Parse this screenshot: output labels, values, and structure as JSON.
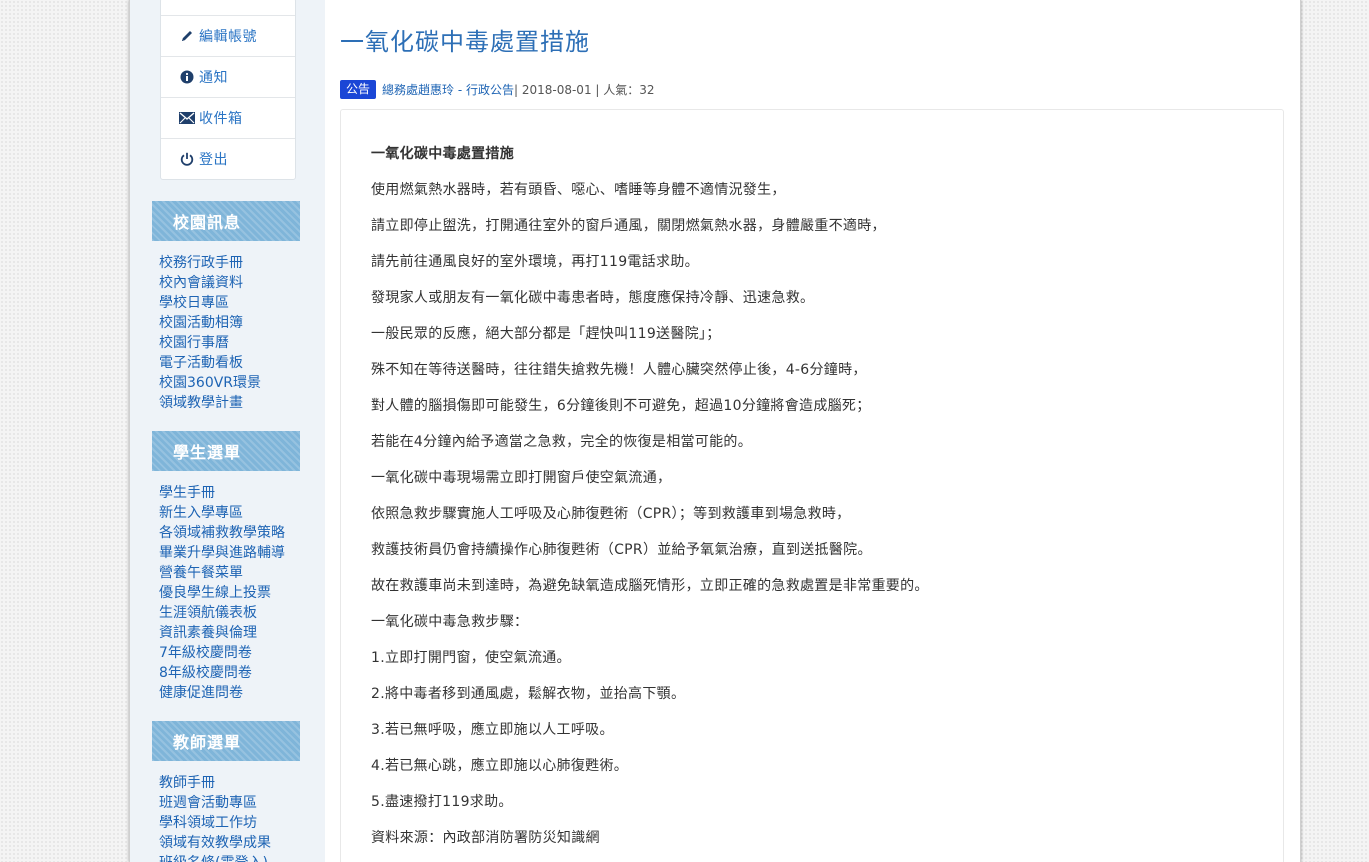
{
  "user_menu": [
    {
      "label": "編輯帳號",
      "icon": "pencil-icon"
    },
    {
      "label": "通知",
      "icon": "info-circle-icon"
    },
    {
      "label": "收件箱",
      "icon": "envelope-icon"
    },
    {
      "label": "登出",
      "icon": "power-icon"
    }
  ],
  "sidebar": {
    "campus": {
      "title": "校園訊息",
      "items": [
        "校務行政手冊",
        "校內會議資料",
        "學校日專區",
        "校園活動相簿",
        "校園行事曆",
        "電子活動看板",
        "校園360VR環景",
        "領域教學計畫"
      ]
    },
    "student": {
      "title": "學生選單",
      "items": [
        "學生手冊",
        "新生入學專區",
        "各領域補救教學策略",
        "畢業升學與進路輔導",
        "營養午餐菜單",
        "優良學生線上投票",
        "生涯領航儀表板",
        "資訊素養與倫理",
        "7年級校慶問卷",
        "8年級校慶問卷",
        "健康促進問卷"
      ]
    },
    "teacher": {
      "title": "教師選單",
      "items": [
        "教師手冊",
        "班週會活動專區",
        "學科領域工作坊",
        "領域有效教學成果",
        "班級名條(需登入)"
      ]
    }
  },
  "article": {
    "title": "一氧化碳中毒處置措施",
    "badge": "公告",
    "author_link": "總務處趙惠玲 - 行政公告",
    "date_views": " | 2018-08-01 | 人氣：32",
    "heading": "一氧化碳中毒處置措施",
    "paragraphs": [
      "使用燃氣熱水器時，若有頭昏、噁心、嗜睡等身體不適情況發生，",
      "請立即停止盥洗，打開通往室外的窗戶通風，關閉燃氣熱水器，身體嚴重不適時，",
      "請先前往通風良好的室外環境，再打119電話求助。",
      "發現家人或朋友有一氧化碳中毒患者時，態度應保持冷靜、迅速急救。",
      "一般民眾的反應，絕大部分都是「趕快叫119送醫院」；",
      "殊不知在等待送醫時，往往錯失搶救先機！人體心臟突然停止後，4-6分鐘時，",
      "對人體的腦損傷即可能發生，6分鐘後則不可避免，超過10分鐘將會造成腦死；",
      "若能在4分鐘內給予適當之急救，完全的恢復是相當可能的。",
      "一氧化碳中毒現場需立即打開窗戶使空氣流通，",
      "依照急救步驟實施人工呼吸及心肺復甦術（CPR）；等到救護車到場急救時，",
      "救護技術員仍會持續操作心肺復甦術（CPR）並給予氧氣治療，直到送抵醫院。",
      "故在救護車尚未到達時，為避免缺氧造成腦死情形，立即正確的急救處置是非常重要的。",
      "一氧化碳中毒急救步驟：",
      "1.立即打開門窗，使空氣流通。",
      "2.將中毒者移到通風處，鬆解衣物，並抬高下顎。",
      "3.若已無呼吸，應立即施以人工呼吸。",
      "4.若已無心跳，應立即施以心肺復甦術。",
      "5.盡速撥打119求助。",
      "資料來源：內政部消防署防災知識網"
    ]
  },
  "colors": {
    "accent": "#2d6fb6",
    "link": "#1e64b4",
    "sidebar_header": "#7fb5d9",
    "badge": "#1a46d6"
  }
}
